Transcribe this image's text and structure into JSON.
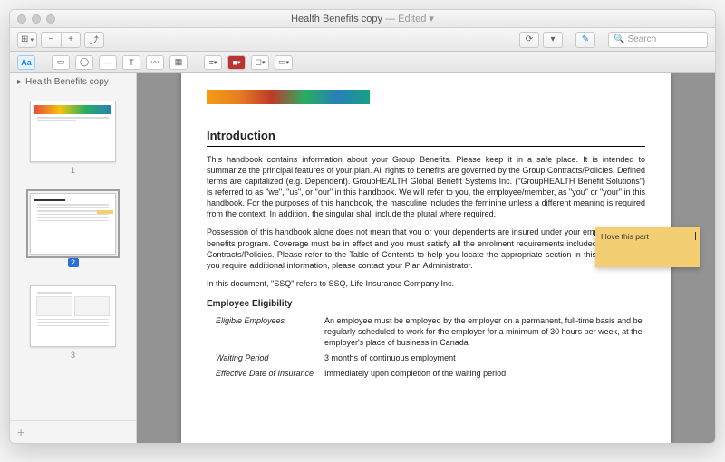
{
  "window": {
    "title": "Health Benefits copy",
    "edited": "— Edited ▾"
  },
  "toolbar": {
    "view": "⊞",
    "zoom_out": "−",
    "zoom_in": "+",
    "share": "⤴",
    "markup": "⟳",
    "annotate": "▾",
    "toolbox": "☰",
    "media": "✎",
    "search_placeholder": "Search",
    "search_icon": "🔍"
  },
  "fmtbar": {
    "aa": "Aa",
    "rect": "▭",
    "circle": "◯",
    "line": "—",
    "arrow": "↗",
    "pen": "✎",
    "textbox": "T",
    "sig": "〰",
    "note": "▦",
    "fill": "■",
    "stroke": "◻",
    "shape": "▭",
    "bar": "≡"
  },
  "sidebar": {
    "doc_title": "Health Benefits copy",
    "disclosure": "▸",
    "pages": [
      {
        "n": "1"
      },
      {
        "n": "2",
        "selected": true
      },
      {
        "n": "3"
      }
    ],
    "add": "+"
  },
  "doc": {
    "heading": "Introduction",
    "p1": "This handbook contains information about your Group Benefits.  Please keep it in a safe place.  It is intended to summarize the principal features of your plan.  All rights to benefits are governed by the Group Contracts/Policies.  Defined terms are capitalized (e.g. Dependent).  GroupHEALTH Global Benefit Systems Inc. (\"GroupHEALTH Benefit Solutions\") is referred to as \"we\", \"us\", or \"our\" in this handbook.  We will refer to you, the employee/member, as \"you\" or \"your\" in this handbook.  For the purposes of this handbook, the masculine includes the feminine unless a different meaning is required from the context.  In addition, the singular shall include the plural where required.",
    "p2": "Possession of this handbook alone does not mean that you or your dependents are insured under your employer's group benefits program.  Coverage must be in effect and you must satisfy all the enrolment requirements included in the Group Contracts/Policies.  Please refer to the Table of Contents to help you locate the appropriate section in this handbook.  If you require additional information, please contact your Plan Administrator.",
    "p3": "In this document, \"SSQ\" refers to SSQ, Life Insurance Company Inc.",
    "sub": "Employee Eligibility",
    "rows": [
      {
        "lbl": "Eligible Employees",
        "val": "An employee must be employed by the employer on a permanent, full-time basis and be regularly scheduled to work for the employer for a minimum of 30 hours per week, at the employer's place of business in Canada"
      },
      {
        "lbl": "Waiting Period",
        "val": "3 months of continuous employment"
      },
      {
        "lbl": "Effective Date of Insurance",
        "val": "Immediately upon completion of the waiting period"
      }
    ]
  },
  "note": {
    "text": "I love this part"
  }
}
